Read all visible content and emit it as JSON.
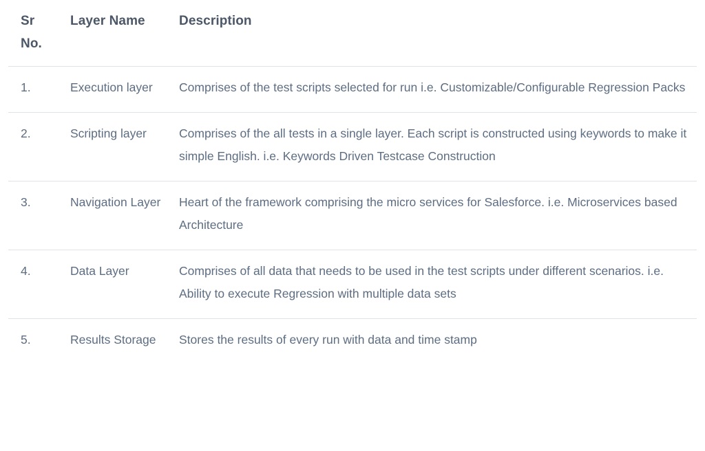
{
  "table": {
    "columns": [
      {
        "key": "sr",
        "label": "Sr\nNo."
      },
      {
        "key": "name",
        "label": "Layer Name"
      },
      {
        "key": "desc",
        "label": "Description"
      }
    ],
    "header": {
      "sr_line1": "Sr",
      "sr_line2": "No.",
      "layer_name": "Layer Name",
      "description": "Description"
    },
    "rows": [
      {
        "sr": "1.",
        "name": "Execution layer",
        "desc": "Comprises of the test scripts selected for run i.e. Customizable/Configurable Regression Packs"
      },
      {
        "sr": "2.",
        "name": "Scripting layer",
        "desc": "Comprises of the all tests in a single layer. Each script is constructed using keywords to make it simple English. i.e. Keywords Driven Testcase Construction"
      },
      {
        "sr": "3.",
        "name": "Navigation Layer",
        "desc": "Heart of the framework comprising the micro services for Salesforce. i.e. Microservices based Architecture"
      },
      {
        "sr": "4.",
        "name": "Data Layer",
        "desc": "Comprises of all data that needs to be used in the test scripts under different scenarios. i.e. Ability to execute Regression with multiple data sets"
      },
      {
        "sr": "5.",
        "name": "Results Storage",
        "desc": "Stores the results of every run with data and time stamp"
      }
    ]
  },
  "colors": {
    "background": "#ffffff",
    "header_text": "#4c5767",
    "body_text": "#5d6d82",
    "divider": "#dfe3e8"
  }
}
